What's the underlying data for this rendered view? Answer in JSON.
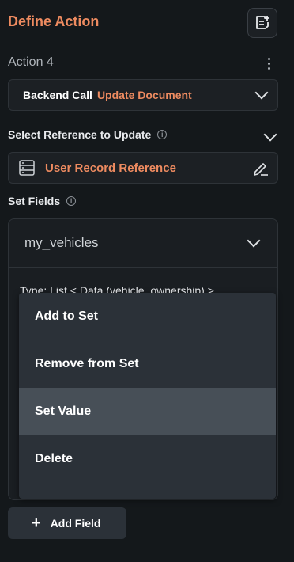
{
  "header": {
    "title": "Define Action",
    "add_icon": "add-note-icon"
  },
  "action": {
    "name": "Action 4",
    "menu_icon": "more-vertical-icon"
  },
  "backend_call": {
    "label": "Backend Call",
    "value": "Update Document"
  },
  "reference": {
    "section_label": "Select Reference to Update",
    "value": "User Record Reference",
    "icon": "database-icon",
    "edit_icon": "edit-icon"
  },
  "set_fields": {
    "section_label": "Set Fields",
    "field_name": "my_vehicles",
    "type_text": "Type: List < Data (vehicle_ownership) >"
  },
  "menu": {
    "items": [
      {
        "label": "Add to Set"
      },
      {
        "label": "Remove from Set"
      },
      {
        "label": "Set Value"
      },
      {
        "label": "Delete"
      }
    ],
    "selected": "Set Value"
  },
  "add_field": {
    "label": "Add Field"
  },
  "colors": {
    "accent": "#ee8b60",
    "background": "#14181b",
    "menu": "#2b3138",
    "menu_active": "#474f57"
  }
}
